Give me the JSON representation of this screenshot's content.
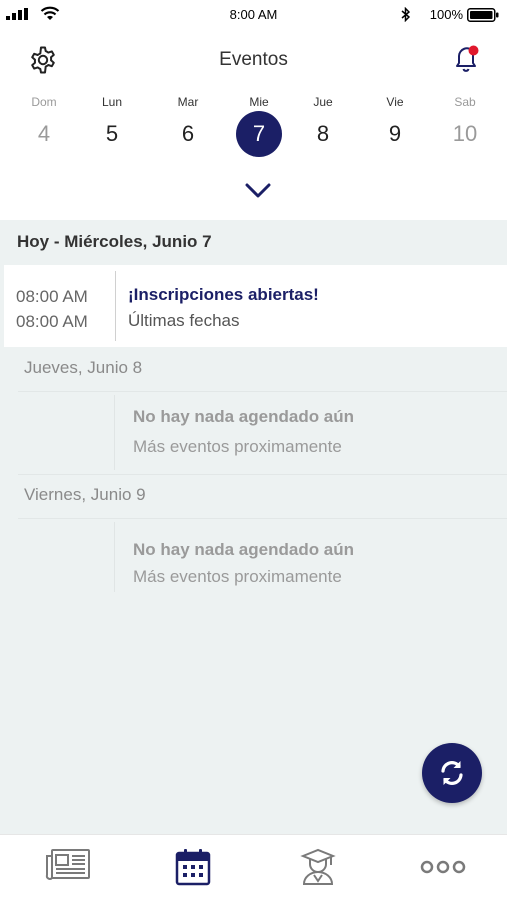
{
  "status_bar": {
    "time": "8:00 AM",
    "battery": "100%"
  },
  "header": {
    "title": "Eventos"
  },
  "week": [
    {
      "name": "Dom",
      "num": "4",
      "state": "faded"
    },
    {
      "name": "Lun",
      "num": "5",
      "state": "normal"
    },
    {
      "name": "Mar",
      "num": "6",
      "state": "normal"
    },
    {
      "name": "Mie",
      "num": "7",
      "state": "selected"
    },
    {
      "name": "Jue",
      "num": "8",
      "state": "normal"
    },
    {
      "name": "Vie",
      "num": "9",
      "state": "normal"
    },
    {
      "name": "Sab",
      "num": "10",
      "state": "faded"
    }
  ],
  "today": {
    "heading": "Hoy - Miércoles, Junio 7",
    "event": {
      "start": "08:00 AM",
      "end": "08:00 AM",
      "title": "¡Inscripciones abiertas!",
      "subtitle": "Últimas fechas"
    }
  },
  "upcoming": [
    {
      "day": "Jueves, Junio 8",
      "empty_title": "No hay nada agendado aún",
      "empty_sub": "Más eventos proximamente"
    },
    {
      "day": "Viernes, Junio 9",
      "empty_title": "No hay nada agendado aún",
      "empty_sub": "Más eventos proximamente"
    }
  ],
  "tabs": [
    {
      "icon": "newspaper-icon",
      "active": false
    },
    {
      "icon": "calendar-icon",
      "active": true
    },
    {
      "icon": "graduate-icon",
      "active": false
    },
    {
      "icon": "more-icon",
      "active": false
    }
  ],
  "colors": {
    "accent": "#1b1f66",
    "notification": "#e0182d",
    "background": "#edf2f2"
  }
}
